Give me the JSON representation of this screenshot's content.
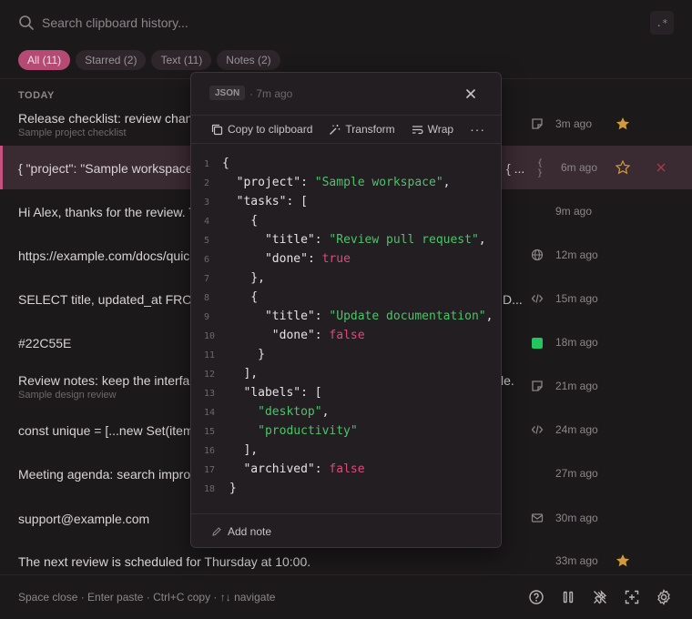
{
  "search": {
    "placeholder": "Search clipboard history...",
    "value": "",
    "regex_label": ".*"
  },
  "filters": [
    {
      "label": "All (11)",
      "active": true
    },
    {
      "label": "Starred (2)",
      "active": false
    },
    {
      "label": "Text (11)",
      "active": false
    },
    {
      "label": "Notes (2)",
      "active": false
    }
  ],
  "section_label": "TODAY",
  "items": [
    {
      "title": "Release checklist: review chang",
      "subtitle": "Sample project checklist",
      "tail": "",
      "type_icon": "note-icon",
      "time": "3m ago",
      "starred": true
    },
    {
      "title": "{ \"project\": \"Sample workspace",
      "subtitle": "",
      "tail": "{ ...",
      "type_icon": "json-braces-icon",
      "time": "6m ago",
      "starred": false,
      "selected": true
    },
    {
      "title": "Hi Alex, thanks for the review. T",
      "subtitle": "",
      "tail": "",
      "type_icon": "",
      "time": "9m ago",
      "starred": false
    },
    {
      "title": "https://example.com/docs/quic",
      "subtitle": "",
      "tail": "",
      "type_icon": "globe-icon",
      "time": "12m ago",
      "starred": false
    },
    {
      "title": "SELECT title, updated_at FROM",
      "subtitle": "",
      "tail": "D...",
      "type_icon": "code-icon",
      "time": "15m ago",
      "starred": false
    },
    {
      "title": "#22C55E",
      "subtitle": "",
      "tail": "",
      "type_icon": "color-swatch-icon",
      "time": "18m ago",
      "starred": false,
      "swatch": "#22C55E"
    },
    {
      "title": "Review notes: keep the interfac",
      "subtitle": "Sample design review",
      "tail": "le.",
      "type_icon": "note-icon",
      "time": "21m ago",
      "starred": false
    },
    {
      "title": "const unique = [...new Set(item",
      "subtitle": "",
      "tail": "",
      "type_icon": "code-icon",
      "time": "24m ago",
      "starred": false
    },
    {
      "title": "Meeting agenda: search impro",
      "subtitle": "",
      "tail": "",
      "type_icon": "",
      "time": "27m ago",
      "starred": false
    },
    {
      "title": "support@example.com",
      "subtitle": "",
      "tail": "",
      "type_icon": "mail-icon",
      "time": "30m ago",
      "starred": false
    },
    {
      "title": "The next review is scheduled for Thursday at 10:00.",
      "subtitle": "",
      "tail": "",
      "type_icon": "",
      "time": "33m ago",
      "starred": true
    }
  ],
  "popover": {
    "lang": "JSON",
    "time": "· 7m ago",
    "toolbar": {
      "copy": "Copy to clipboard",
      "transform": "Transform",
      "wrap": "Wrap",
      "more": "···"
    },
    "code_lines": [
      "{",
      "  \"project\": \"Sample workspace\",",
      "  \"tasks\": [",
      "    {",
      "      \"title\": \"Review pull request\",",
      "      \"done\": true",
      "    },",
      "    {",
      "      \"title\": \"Update documentation\",",
      "       \"done\": false",
      "     }",
      "   ],",
      "   \"labels\": [",
      "     \"desktop\",",
      "     \"productivity\"",
      "   ],",
      "   \"archived\": false",
      " }"
    ],
    "add_note": "Add note"
  },
  "footer": {
    "hint": "Space close · Enter paste · Ctrl+C copy · ↑↓ navigate"
  },
  "colors": {
    "accent": "#b54a74",
    "star": "#d29a3c",
    "string": "#4fc26a",
    "bool": "#e04a7a",
    "delete": "#a23a4e"
  }
}
